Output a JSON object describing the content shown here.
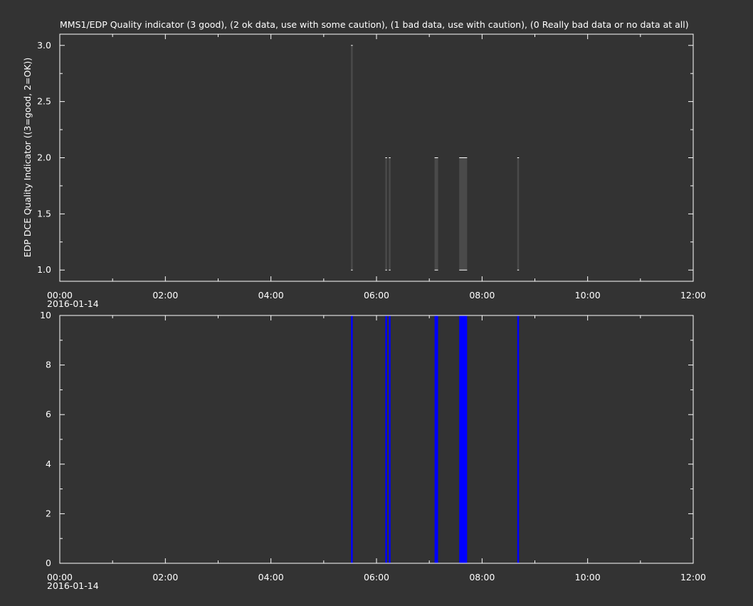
{
  "chart_data": [
    {
      "type": "bar",
      "title": "MMS1/EDP  Quality indicator (3 good), (2 ok data, use with some caution), (1 bad data, use with caution), (0 Really bad data or no data at all)",
      "ylabel": "EDP DCE Quality Indicator ((3=good, 2=OK))",
      "xlabel": "",
      "xlim": [
        "00:00",
        "12:00"
      ],
      "ylim": [
        0.9,
        3.1
      ],
      "x_tick_labels": [
        "00:00",
        "02:00",
        "04:00",
        "06:00",
        "08:00",
        "10:00",
        "12:00"
      ],
      "x_date_label": "2016-01-14",
      "y_tick_labels": [
        "1.0",
        "1.5",
        "2.0",
        "2.5",
        "3.0"
      ],
      "y_ticks": [
        1.0,
        1.5,
        2.0,
        2.5,
        3.0
      ],
      "bar_color": "#4a4a4a",
      "bars": [
        {
          "start": "05:31",
          "end": "05:33",
          "low": 1,
          "high": 3
        },
        {
          "start": "06:10",
          "end": "06:12",
          "low": 1,
          "high": 2
        },
        {
          "start": "06:14",
          "end": "06:16",
          "low": 1,
          "high": 2
        },
        {
          "start": "07:06",
          "end": "07:10",
          "low": 1,
          "high": 2
        },
        {
          "start": "07:34",
          "end": "07:43",
          "low": 1,
          "high": 2
        },
        {
          "start": "08:40",
          "end": "08:42",
          "low": 1,
          "high": 2
        }
      ]
    },
    {
      "type": "bar",
      "xlim": [
        "00:00",
        "12:00"
      ],
      "ylim": [
        0,
        10
      ],
      "x_tick_labels": [
        "00:00",
        "02:00",
        "04:00",
        "06:00",
        "08:00",
        "10:00",
        "12:00"
      ],
      "x_date_label": "2016-01-14",
      "y_tick_labels": [
        "0",
        "2",
        "4",
        "6",
        "8",
        "10"
      ],
      "y_ticks": [
        0,
        2,
        4,
        6,
        8,
        10
      ],
      "bar_color": "#0000ff",
      "bars": [
        {
          "start": "05:31",
          "end": "05:33",
          "low": 0,
          "high": 10
        },
        {
          "start": "06:10",
          "end": "06:12",
          "low": 0,
          "high": 10
        },
        {
          "start": "06:14",
          "end": "06:16",
          "low": 0,
          "high": 10
        },
        {
          "start": "07:06",
          "end": "07:10",
          "low": 0,
          "high": 10
        },
        {
          "start": "07:34",
          "end": "07:43",
          "low": 0,
          "high": 10
        },
        {
          "start": "08:40",
          "end": "08:42",
          "low": 0,
          "high": 10
        }
      ]
    }
  ]
}
